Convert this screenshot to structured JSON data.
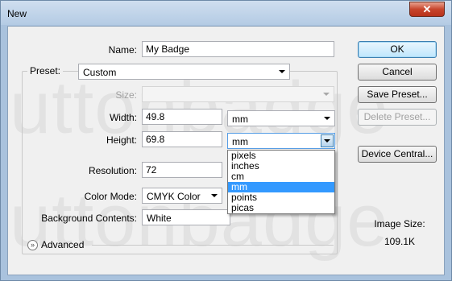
{
  "window": {
    "title": "New",
    "close_glyph": "✕"
  },
  "watermark": {
    "line1": "uttonbadge",
    "line2": "uttonbadge"
  },
  "form": {
    "name": {
      "label": "Name:",
      "value": "My Badge"
    },
    "preset": {
      "label": "Preset:",
      "value": "Custom"
    },
    "size": {
      "label": "Size:",
      "value": ""
    },
    "width": {
      "label": "Width:",
      "value": "49.8",
      "unit": "mm"
    },
    "height": {
      "label": "Height:",
      "value": "69.8",
      "unit": "mm"
    },
    "resolution": {
      "label": "Resolution:",
      "value": "72"
    },
    "color_mode": {
      "label": "Color Mode:",
      "value": "CMYK Color"
    },
    "background": {
      "label": "Background Contents:",
      "value": "White"
    },
    "advanced_label": "Advanced",
    "advanced_icon": "chevron-double-down-icon"
  },
  "unit_dropdown": {
    "options": [
      "pixels",
      "inches",
      "cm",
      "mm",
      "points",
      "picas"
    ],
    "selected": "mm"
  },
  "buttons": {
    "ok": "OK",
    "cancel": "Cancel",
    "save_preset": "Save Preset...",
    "delete_preset": "Delete Preset...",
    "device_central": "Device Central..."
  },
  "image_size": {
    "label": "Image Size:",
    "value": "109.1K"
  },
  "colors": {
    "highlight": "#3399ff",
    "title_bar": "#b4cbe4",
    "close_button": "#c7452c"
  }
}
